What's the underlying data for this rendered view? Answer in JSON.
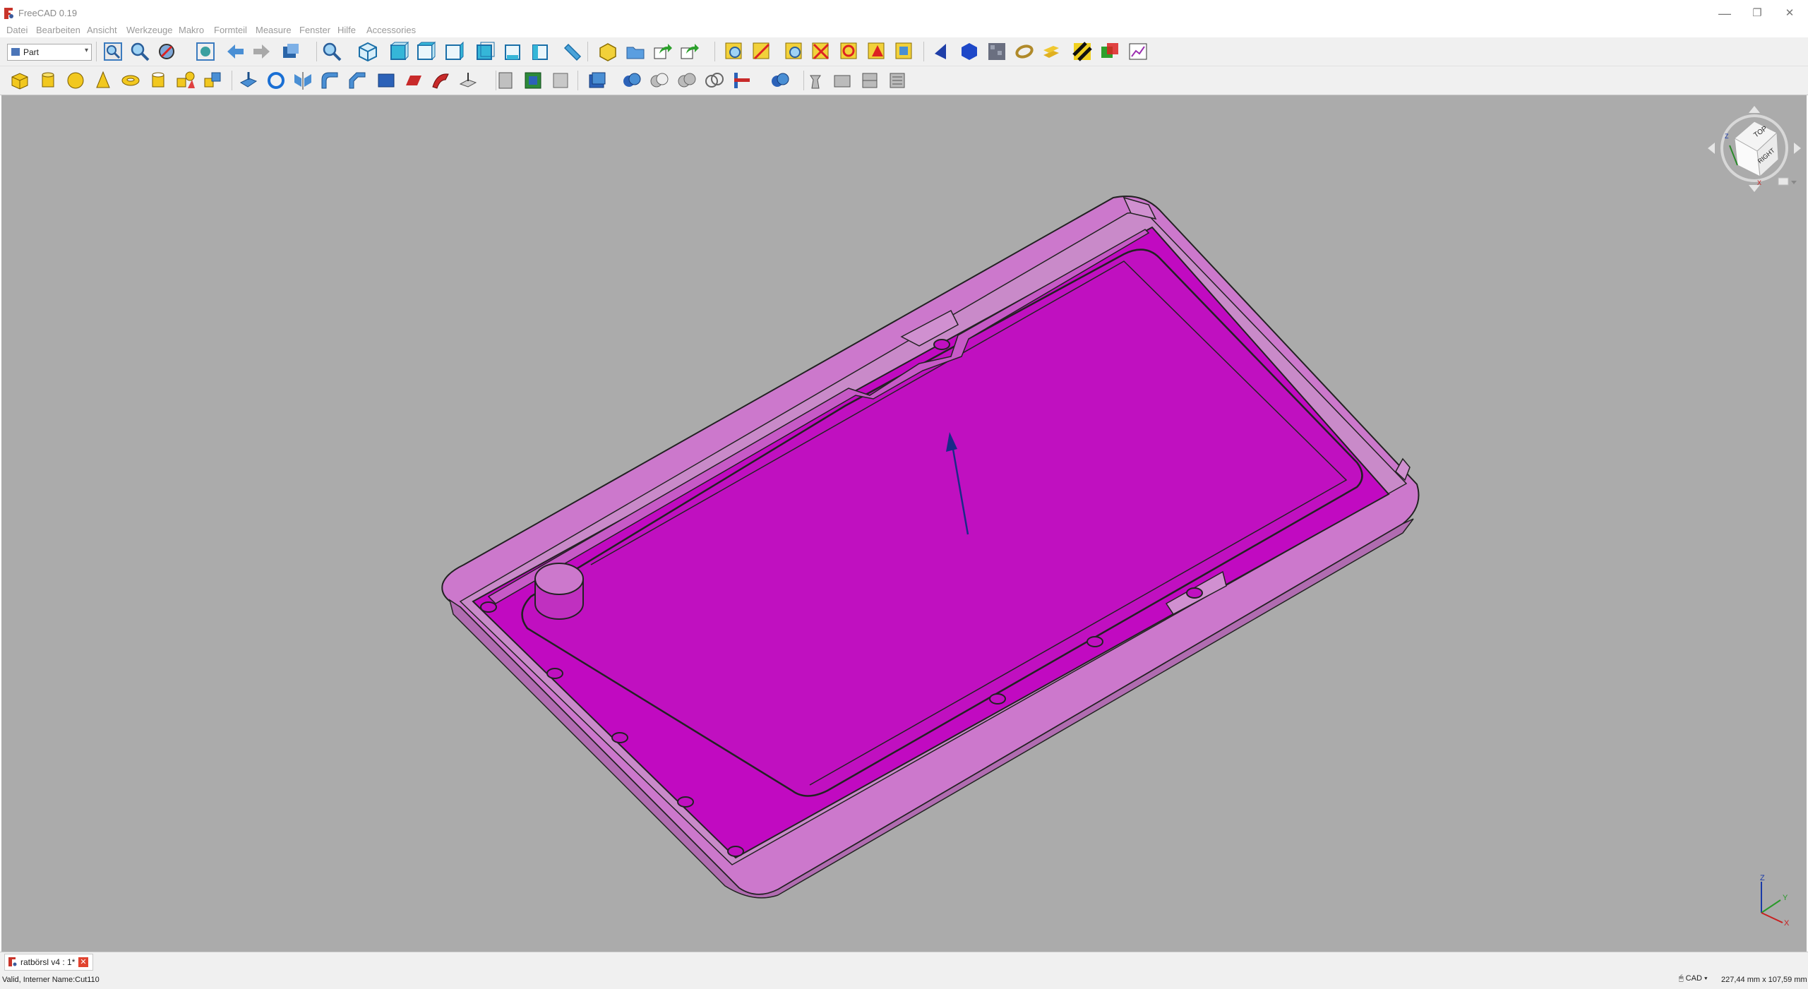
{
  "window": {
    "title": "FreeCAD 0.19",
    "controls": {
      "minimize": "—",
      "restore": "❐",
      "close": "✕"
    }
  },
  "menu": [
    "Datei",
    "Bearbeiten",
    "Ansicht",
    "Werkzeuge",
    "Makro",
    "Formteil",
    "Measure",
    "Fenster",
    "Hilfe",
    "Accessories"
  ],
  "toolbar": {
    "workbench": "Part",
    "row1_icons": [
      "std-new-icon",
      "fit-all-icon",
      "fit-selection-icon",
      "draw-style-icon",
      "bounding-box-icon",
      "nav-back-icon",
      "nav-forward-icon",
      "stereo-icon",
      "zoom-icon",
      "isometric-view-icon",
      "front-view-icon",
      "top-view-icon",
      "right-view-icon",
      "rear-view-icon",
      "bottom-view-icon",
      "left-view-icon",
      "measure-distance-icon",
      "part-icon",
      "group-icon",
      "link-icon",
      "link-actions-icon",
      "fit-view-icon",
      "fit-select-icon",
      "select-filter-icon",
      "restore-view-icon",
      "rotate-view-icon",
      "annotate-icon",
      "section-view-icon",
      "clipping-icon",
      "object-blue-icon",
      "object-hex-icon",
      "material-icon",
      "ring-icon",
      "stack-icon",
      "hazard-icon",
      "overlay-icon",
      "chart-icon"
    ],
    "row2_icons": [
      "part-box-icon",
      "part-cylinder-icon",
      "part-sphere-icon",
      "part-cone-icon",
      "part-torus-icon",
      "part-tube-icon",
      "part-primitives-icon",
      "part-shape-builder-icon",
      "part-extrude-icon",
      "part-revolve-icon",
      "part-mirror-icon",
      "part-fillet-icon",
      "part-chamfer-icon",
      "part-make-face-icon",
      "part-ruled-surface-icon",
      "part-loft-icon",
      "part-sweep-icon",
      "part-section-icon",
      "part-cross-section-icon",
      "part-offset-icon",
      "part-thickness-icon",
      "part-compound-icon",
      "part-boolean-icon",
      "part-cut-icon",
      "part-fuse-icon",
      "part-common-icon",
      "part-join-icon",
      "part-split-icon",
      "part-check-geometry-icon",
      "part-defeaturing-icon",
      "part-attachment-icon",
      "part-color-icon"
    ]
  },
  "viewport": {
    "background": "#ababab",
    "model_color": "#c10ac1",
    "model_light": "#cc78cc",
    "navcube": {
      "top_face": "TOP",
      "right_face": "RIGHT",
      "axes": [
        "X",
        "Y",
        "Z"
      ]
    }
  },
  "document_tab": {
    "label": "ratbörsl v4 : 1*"
  },
  "status": {
    "message": "Valid, Interner Name:Cut110",
    "nav_style": "CAD",
    "dimensions": "227,44 mm x 107,59 mm"
  }
}
